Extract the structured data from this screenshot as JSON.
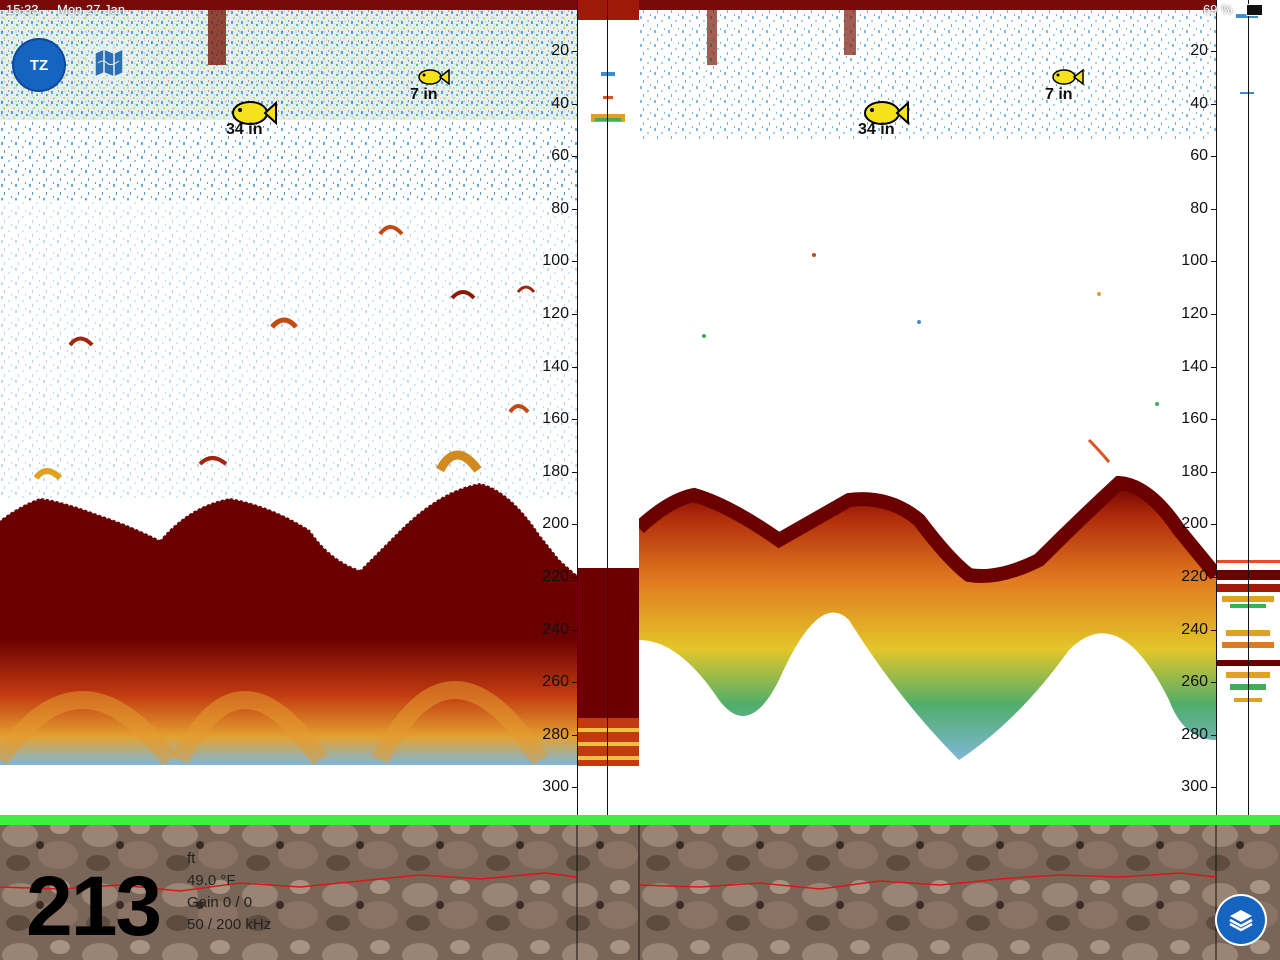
{
  "status_bar": {
    "time": "15:33",
    "date": "Mon 27 Jan",
    "battery": "69 %"
  },
  "app": {
    "tz_button_label": "TZ",
    "map_icon": "map-icon",
    "layers_icon": "layers-icon"
  },
  "left_pane": {
    "fish": [
      {
        "size": "34 in"
      },
      {
        "size": "7 in"
      }
    ]
  },
  "right_pane": {
    "fish": [
      {
        "size": "34 in"
      },
      {
        "size": "7 in"
      }
    ]
  },
  "depth_scale": [
    "20",
    "40",
    "60",
    "80",
    "100",
    "120",
    "140",
    "160",
    "180",
    "200",
    "220",
    "240",
    "260",
    "280",
    "300"
  ],
  "readout": {
    "depth": "213",
    "unit": "ft",
    "temperature": "49.0 °F",
    "gain": "Gain 0 / 0",
    "frequency": "50 / 200 kHz"
  },
  "colors": {
    "bottom_echo": "#6a0000",
    "weak_echo": "#3a8fd0",
    "mid_echo": "#e0c020",
    "green_bar": "#3ef03e",
    "fish_symbol": "#f5e21a"
  }
}
